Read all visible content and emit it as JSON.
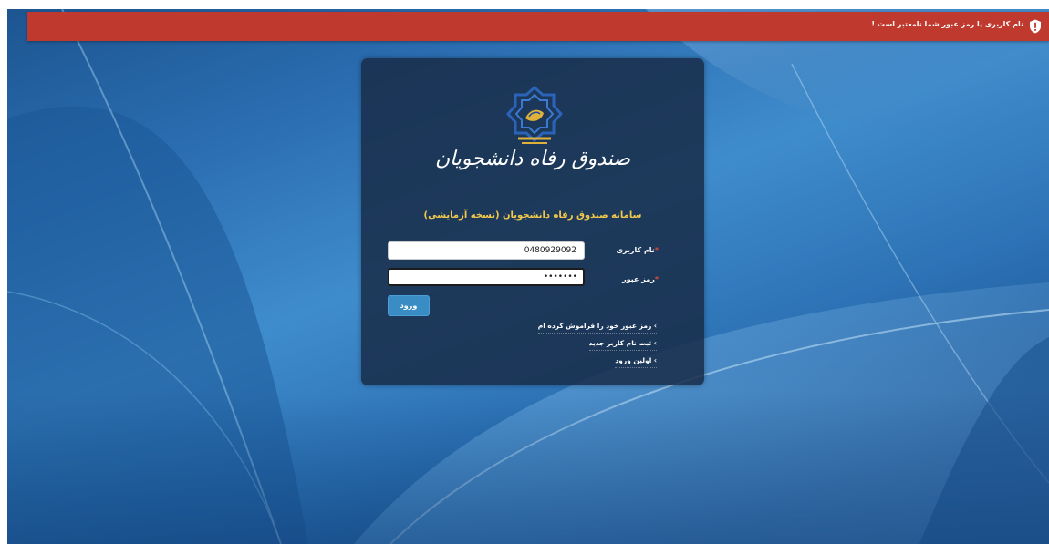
{
  "error_message": {
    "text": "نام کاربری یا رمز عبور شما نامعتبر است !",
    "icon": "shield-exclamation-icon",
    "color": "#c0392e"
  },
  "brand": {
    "logo_text": "صندوق رفاه دانشجویان",
    "logo_icon": "welfare-fund-emblem-icon"
  },
  "login": {
    "system_title": "سامانه صندوق رفاه دانشجویان (نسخه آزمایشی)",
    "username_label": "نام کاربری",
    "username_value": "0480929092",
    "password_label": "رمز عبور",
    "password_value": "•••••••",
    "required_marker": "*",
    "submit_label": "ورود"
  },
  "links": {
    "forgot_password": "رمز عبور خود را فراموش کرده ام",
    "register": "ثبت نام کاربر جدید",
    "first_login": "اولین ورود",
    "bullet": "›"
  },
  "colors": {
    "panel": "#182c48",
    "title_accent": "#f2c94c",
    "button": "#3a8dc4"
  }
}
